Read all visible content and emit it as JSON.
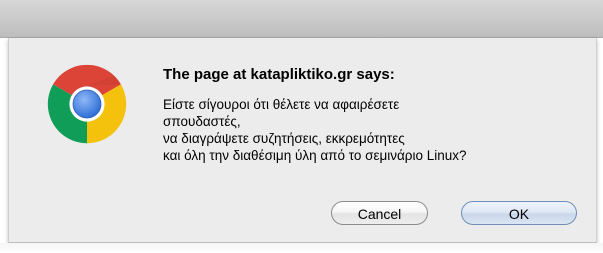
{
  "dialog": {
    "title": "The page at katapliktiko.gr says:",
    "message_lines": [
      "Είστε σίγουροι ότι θέλετε να αφαιρέσετε",
      "σπουδαστές,",
      "να διαγράψετε συζητήσεις, εκκρεμότητες",
      "και όλη την διαθέσιμη ύλη από το σεμινάριο Linux?"
    ],
    "buttons": {
      "cancel_label": "Cancel",
      "ok_label": "OK"
    },
    "icon": "chrome-logo-icon"
  },
  "colors": {
    "chrome_red": "#db4437",
    "chrome_yellow": "#f4c20d",
    "chrome_green": "#0f9d58",
    "chrome_blue": "#4285f4",
    "dialog_bg": "#ececec"
  }
}
